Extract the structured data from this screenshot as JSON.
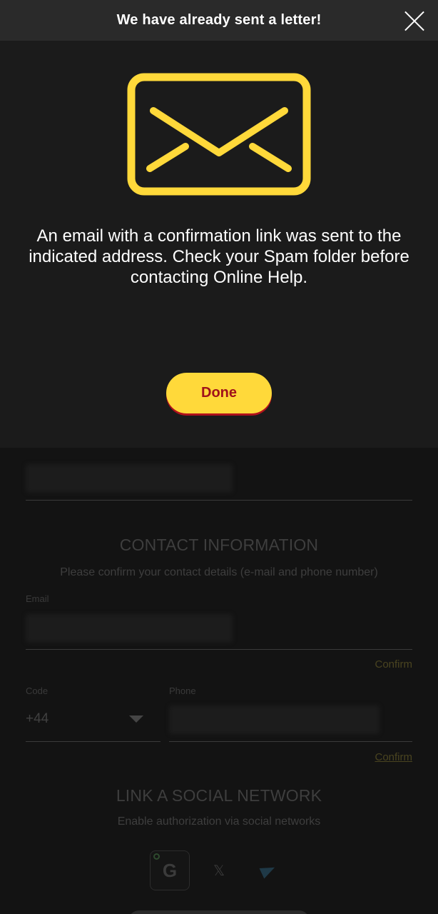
{
  "modal": {
    "title": "We have already sent a letter!",
    "message": "An email with a confirmation link was sent to the indicated address. Check your Spam folder before contacting Online Help.",
    "done_label": "Done",
    "icon": "envelope-icon",
    "accent_color": "#ffd93a"
  },
  "background_page": {
    "contact_section_title": "CONTACT INFORMATION",
    "contact_section_subtitle": "Please confirm your contact details (e-mail and phone number)",
    "email_label": "Email",
    "email_confirm": "Confirm",
    "code_label": "Code",
    "code_value": "+44",
    "phone_label": "Phone",
    "phone_confirm": "Confirm",
    "social_title": "LINK A SOCIAL NETWORK",
    "social_subtitle": "Enable authorization via social networks",
    "social_networks": [
      "google-icon",
      "x-icon",
      "telegram-icon"
    ]
  }
}
